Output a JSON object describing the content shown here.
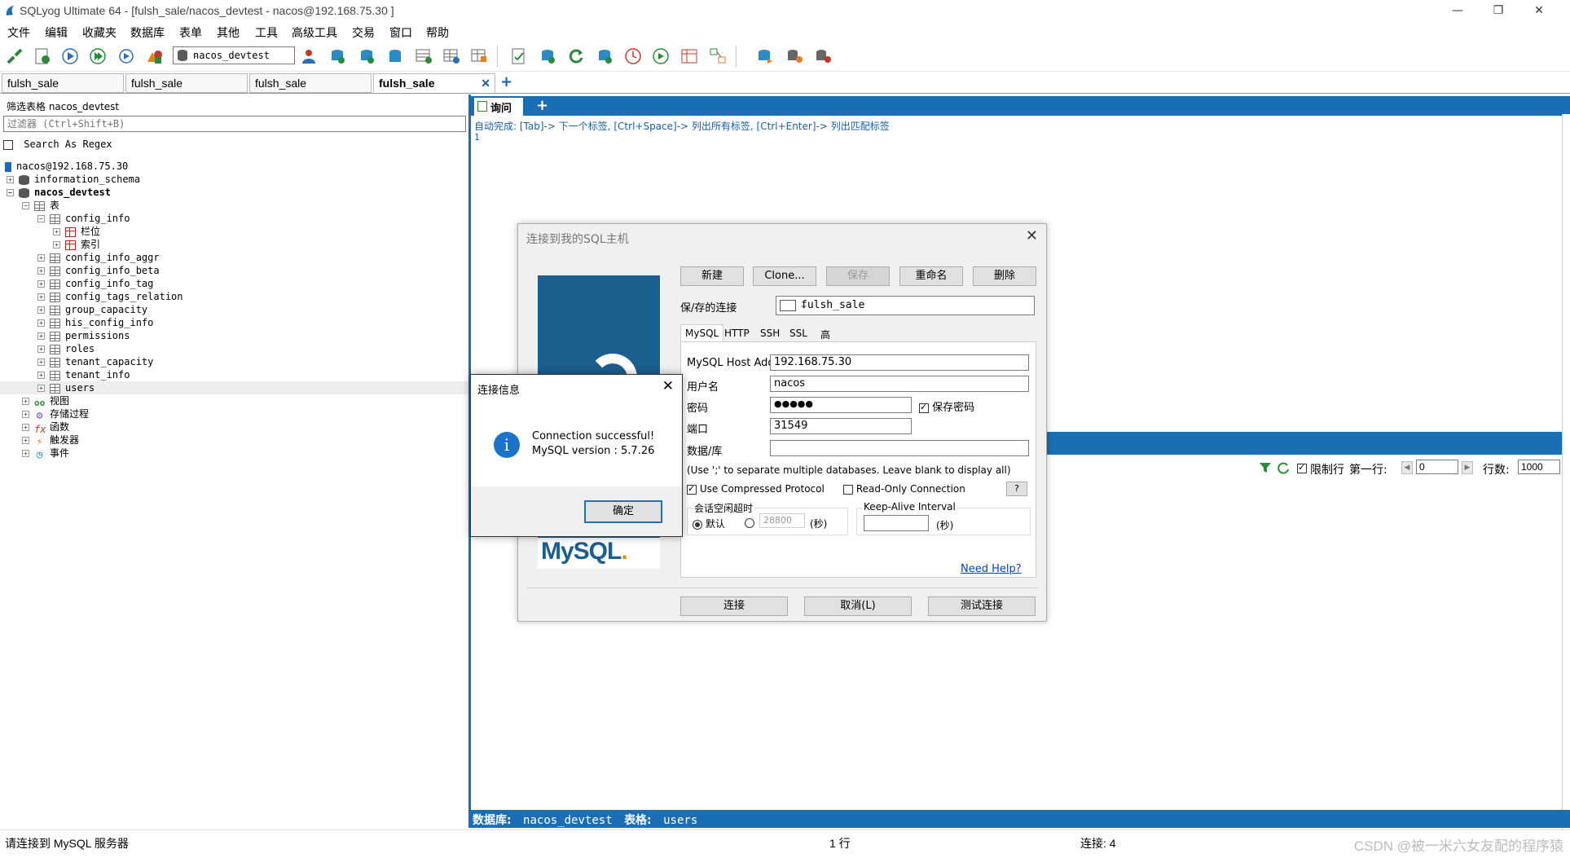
{
  "window": {
    "title": "SQLyog Ultimate 64 - [fulsh_sale/nacos_devtest - nacos@192.168.75.30 ]",
    "minimize": "—",
    "restore": "❐",
    "close": "✕"
  },
  "menu": [
    "文件",
    "编辑",
    "收藏夹",
    "数据库",
    "表单",
    "其他",
    "工具",
    "高级工具",
    "交易",
    "窗口",
    "帮助"
  ],
  "toolbar": {
    "db_select": "nacos_devtest"
  },
  "conn_tabs": [
    {
      "label": "fulsh_sale"
    },
    {
      "label": "fulsh_sale"
    },
    {
      "label": "fulsh_sale"
    },
    {
      "label": "fulsh_sale",
      "active": true
    }
  ],
  "conn_tab_close": "✕",
  "conn_tab_add": "+",
  "left": {
    "filter_label": "筛选表格 nacos_devtest",
    "filter_placeholder": "过滤器 (Ctrl+Shift+B)",
    "regex_label": "Search As Regex",
    "tree": {
      "server": "nacos@192.168.75.30",
      "db1": "information_schema",
      "db2": "nacos_devtest",
      "tables_folder": "表",
      "config_info": "config_info",
      "columns": "栏位",
      "indexes": "索引",
      "tables": [
        "config_info_aggr",
        "config_info_beta",
        "config_info_tag",
        "config_tags_relation",
        "group_capacity",
        "his_config_info",
        "permissions",
        "roles",
        "tenant_capacity",
        "tenant_info",
        "users"
      ],
      "views": "视图",
      "procs": "存储过程",
      "funcs": "函数",
      "triggers": "触发器",
      "events": "事件"
    }
  },
  "query": {
    "tab_label": "询问",
    "add": "+",
    "hint": "自动完成: [Tab]-> 下一个标签, [Ctrl+Space]-> 列出所有标签, [Ctrl+Enter]-> 列出匹配标签",
    "line": "1"
  },
  "result_bar": {
    "limit_label": "限制行",
    "first_row_label": "第一行:",
    "first_row": "0",
    "rows_label": "行数:",
    "rows": "1000",
    "limit_checked": true
  },
  "db_info": {
    "db_label": "数据库:",
    "db": "nacos_devtest",
    "table_label": "表格:",
    "table": "users"
  },
  "status": {
    "left": "请连接到 MySQL 服务器",
    "rows": "1 行",
    "connections": "连接: 4",
    "watermark": "CSDN @被一米六女友配的程序猿"
  },
  "conn_dialog": {
    "title": "连接到我的SQL主机",
    "close": "✕",
    "buttons": {
      "new": "新建",
      "clone": "Clone...",
      "save": "保存",
      "rename": "重命名",
      "delete": "删除"
    },
    "saved_label": "保/存的连接",
    "saved_value": "fulsh_sale",
    "tabs": [
      "MySQL",
      "HTTP",
      "SSH",
      "SSL",
      "高级功能"
    ],
    "host_label": "MySQL Host Address",
    "host": "192.168.75.30",
    "user_label": "用户名",
    "user": "nacos",
    "pass_label": "密码",
    "pass": "●●●●●",
    "save_pass": "保存密码",
    "port_label": "端口",
    "port": "31549",
    "db_label": "数据/库",
    "db": "",
    "db_note": "(Use ';' to separate multiple databases. Leave blank to display all)",
    "compressed": "Use Compressed Protocol",
    "readonly": "Read-Only Connection",
    "help_q": "?",
    "timeout_label": "会话空闲超时",
    "default": "默认",
    "timeout_value": "28800",
    "sec": "(秒)",
    "keepalive_label": "Keep-Alive Interval",
    "keepalive_value": "",
    "need_help": "Need Help?",
    "connect": "连接",
    "cancel": "取消(L)",
    "test": "测试连接",
    "logo_main": "MySQL",
    "logo_dot": "."
  },
  "info_dialog": {
    "title": "连接信息",
    "close": "✕",
    "icon": "i",
    "line1": "Connection successful!",
    "line2": "MySQL version : 5.7.26",
    "ok": "确定"
  },
  "colors": {
    "accent": "#1a6fb4",
    "link": "#0645ad",
    "hint": "#1b5ea8"
  }
}
